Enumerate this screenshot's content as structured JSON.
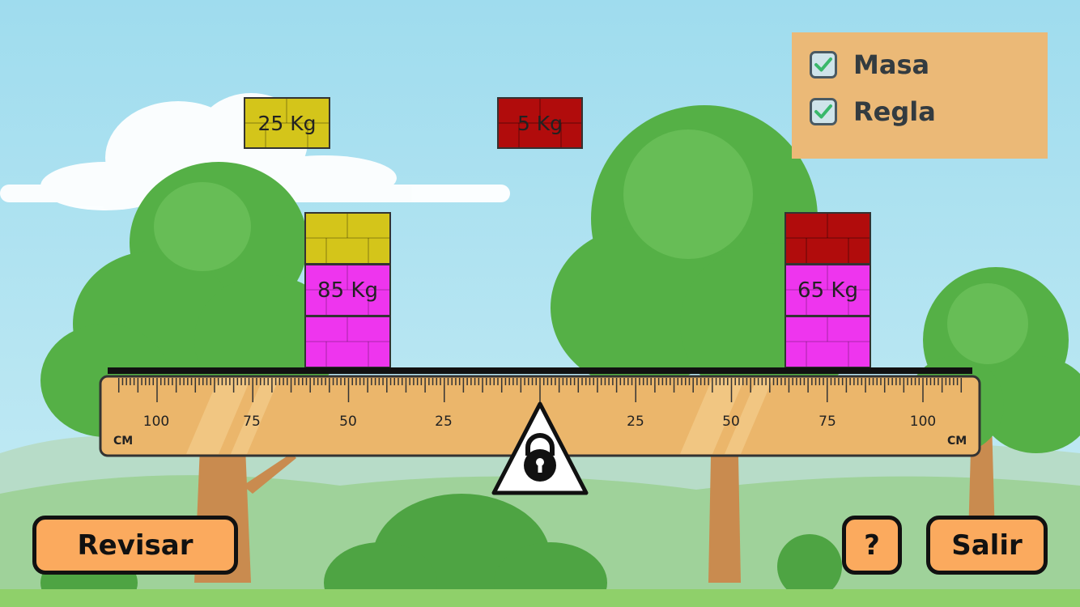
{
  "options": {
    "masa": {
      "label": "Masa",
      "checked": true
    },
    "regla": {
      "label": "Regla",
      "checked": true
    }
  },
  "loose_blocks": {
    "yellow": {
      "label": "25 Kg",
      "color": "#d4c51a"
    },
    "red": {
      "label": "5 Kg",
      "color": "#b10c0c"
    }
  },
  "stacks": {
    "left": {
      "label": "85 Kg",
      "blocks": [
        "yellow",
        "magenta",
        "magenta"
      ]
    },
    "right": {
      "label": "65 Kg",
      "blocks": [
        "red",
        "magenta",
        "magenta"
      ]
    }
  },
  "block_colors": {
    "yellow": "#d4c51a",
    "red": "#b10c0c",
    "magenta": "#ee35ee"
  },
  "ruler": {
    "left_labels": [
      "100",
      "75",
      "50",
      "25"
    ],
    "right_labels": [
      "25",
      "50",
      "75",
      "100"
    ],
    "unit_left": "CM",
    "unit_right": "CM",
    "color": "#ebb66b"
  },
  "fulcrum": {
    "icon": "lock-icon",
    "locked": true
  },
  "buttons": {
    "check": "Revisar",
    "help": "?",
    "exit": "Salir"
  },
  "colors": {
    "sky": "#9fdcee",
    "grass": "#8fd06a",
    "tree": "#55b046",
    "button": "#fbaa5e",
    "panel": "#ebb977"
  }
}
